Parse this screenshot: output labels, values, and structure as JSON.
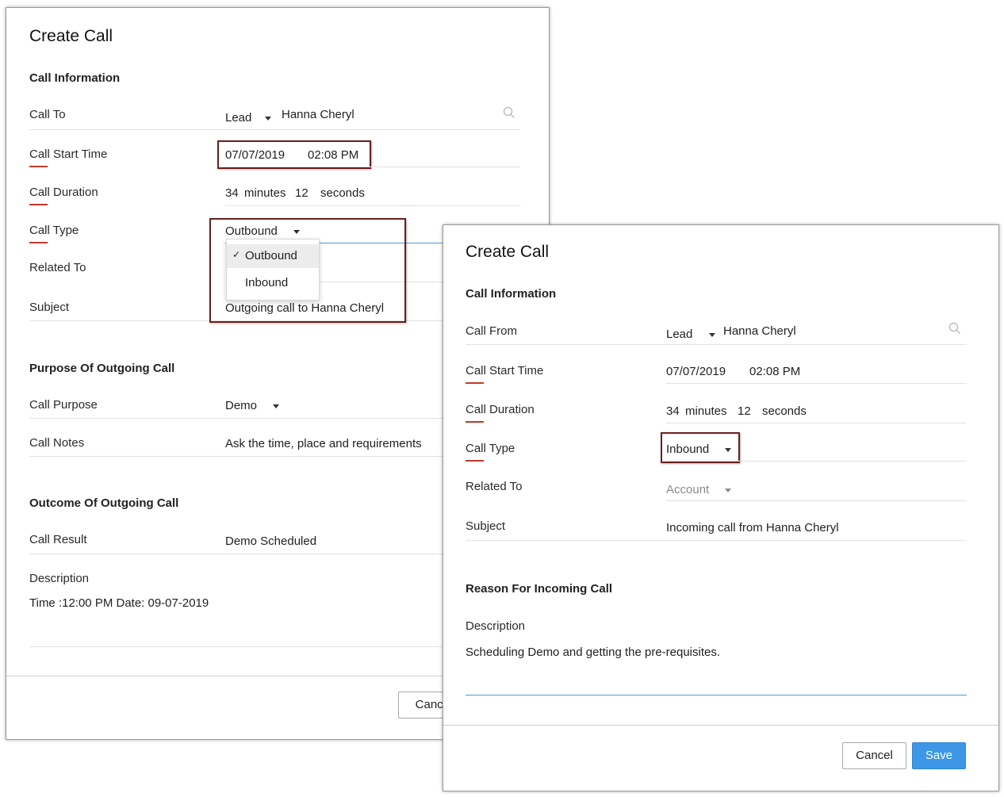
{
  "left": {
    "title": "Create Call",
    "section_info": "Call Information",
    "call_to": {
      "label": "Call To",
      "module": "Lead",
      "name": "Hanna Cheryl"
    },
    "start_time": {
      "label": "Call Start Time",
      "date": "07/07/2019",
      "time": "02:08 PM"
    },
    "duration": {
      "label": "Call Duration",
      "minutes": "34",
      "minutes_unit": "minutes",
      "seconds": "12",
      "seconds_unit": "seconds"
    },
    "call_type": {
      "label": "Call Type",
      "value": "Outbound",
      "options": [
        "Outbound",
        "Inbound"
      ],
      "check": "✓"
    },
    "related_to": {
      "label": "Related To"
    },
    "subject": {
      "label": "Subject",
      "value": "Outgoing call to Hanna Cheryl"
    },
    "section_purpose": "Purpose Of Outgoing Call",
    "call_purpose": {
      "label": "Call Purpose",
      "value": "Demo"
    },
    "call_notes": {
      "label": "Call Notes",
      "value": "Ask the time, place and requirements"
    },
    "section_outcome": "Outcome Of Outgoing Call",
    "call_result": {
      "label": "Call Result",
      "value": "Demo Scheduled"
    },
    "description": {
      "label": "Description",
      "value": "Time :12:00 PM Date: 09-07-2019"
    },
    "cancel_label": "Cancel"
  },
  "right": {
    "title": "Create Call",
    "section_info": "Call Information",
    "call_from": {
      "label": "Call From",
      "module": "Lead",
      "name": "Hanna Cheryl"
    },
    "start_time": {
      "label": "Call Start Time",
      "date": "07/07/2019",
      "time": "02:08 PM"
    },
    "duration": {
      "label": "Call Duration",
      "minutes": "34",
      "minutes_unit": "minutes",
      "seconds": "12",
      "seconds_unit": "seconds"
    },
    "call_type": {
      "label": "Call Type",
      "value": "Inbound"
    },
    "related_to": {
      "label": "Related To",
      "value": "Account"
    },
    "subject": {
      "label": "Subject",
      "value": "Incoming call from Hanna Cheryl"
    },
    "section_reason": "Reason For Incoming Call",
    "description": {
      "label": "Description",
      "value": "Scheduling Demo and getting the pre-requisites."
    },
    "cancel_label": "Cancel",
    "save_label": "Save"
  },
  "colors": {
    "highlight": "#6b1e1e",
    "required": "#c0392b",
    "accent": "#3d97e6",
    "focus": "#4a9fd0"
  },
  "icons": [
    "search-icon",
    "chevron-down-icon",
    "check-icon"
  ]
}
